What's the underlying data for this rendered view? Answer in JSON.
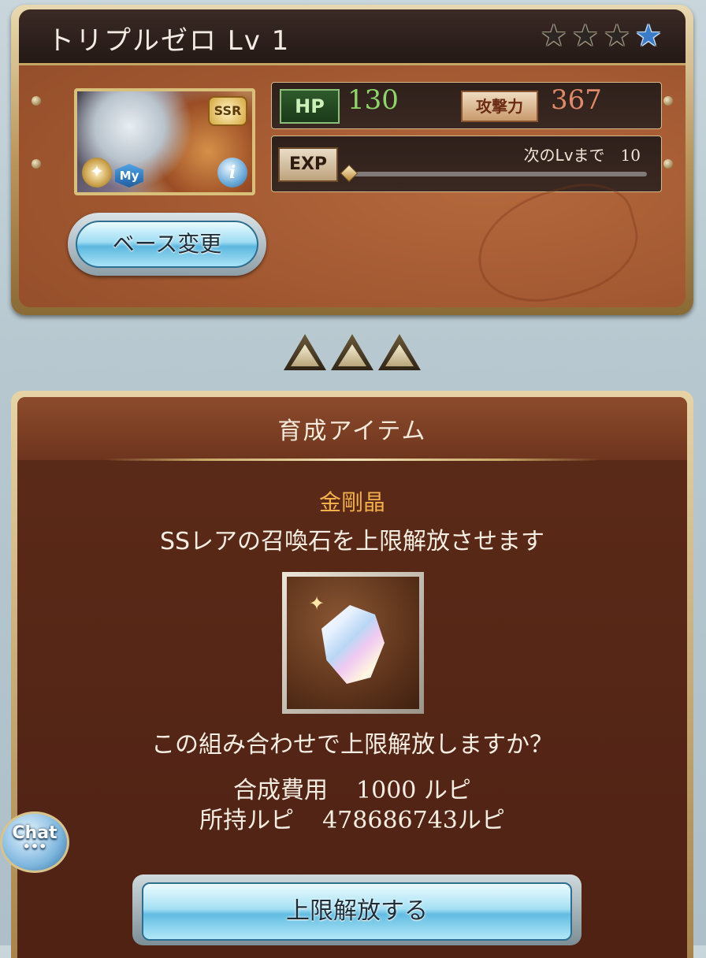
{
  "character": {
    "name": "トリプルゼロ Lv 1",
    "stars_total": 4,
    "stars_filled": 1,
    "rarity_badge": "SSR",
    "my_badge": "My",
    "info_glyph": "i"
  },
  "stats": {
    "hp_label": "HP",
    "hp_value": "130",
    "atk_label": "攻撃力",
    "atk_value": "367"
  },
  "exp": {
    "label": "EXP",
    "next_label": "次のLvまで",
    "next_value": "10",
    "progress": 0
  },
  "buttons": {
    "base_change": "ベース変更",
    "limit_break": "上限解放する",
    "chat": "Chat",
    "chat_dots": "•••"
  },
  "section": {
    "title": "育成アイテム",
    "item_name": "金剛晶",
    "item_desc": "SSレアの召喚石を上限解放させます",
    "confirm": "この組み合わせで上限解放しますか？",
    "cost_label": "合成費用",
    "cost_value": "1000 ルピ",
    "owned_label": "所持ルピ",
    "owned_value": "478686743ルピ"
  },
  "icons": {
    "star": "star-icon",
    "element": "light-element-icon",
    "info": "info-icon",
    "crystal": "diamond-crystal-icon",
    "triangle": "uncap-triangle-icon"
  },
  "colors": {
    "hp": "#8fd66a",
    "attack": "#e08a6a",
    "item_name": "#f2b04a",
    "star_filled": "#3c7bc8"
  }
}
